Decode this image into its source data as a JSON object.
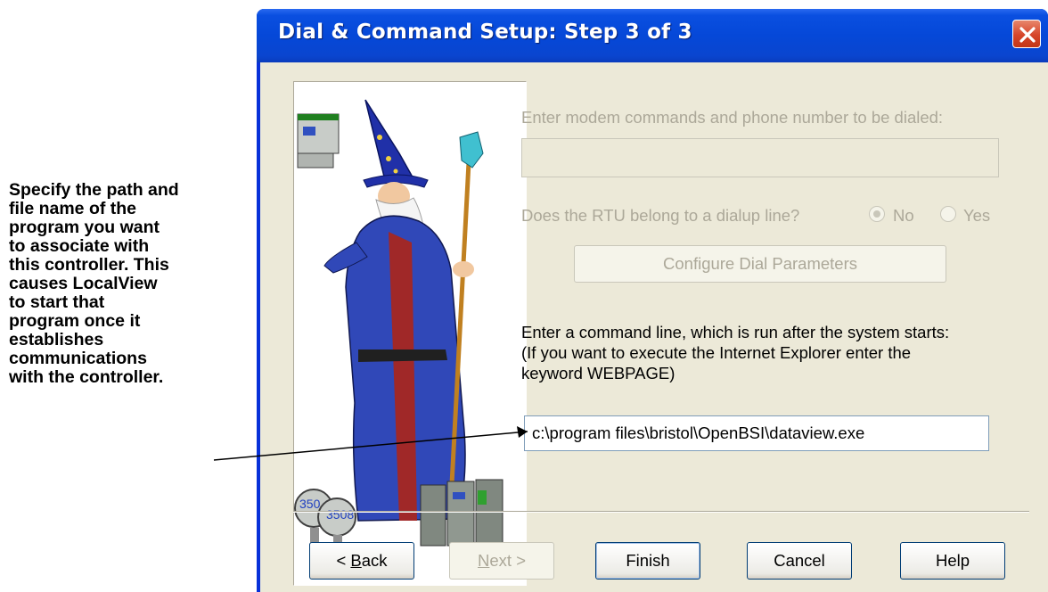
{
  "callout": {
    "lines": [
      "Specify the path and",
      "file name of the",
      "program you want",
      "to associate with",
      "this controller. This",
      "causes LocalView",
      "to start that",
      "program once it",
      "establishes",
      "communications",
      "with the controller."
    ]
  },
  "window": {
    "title": "Dial & Command Setup: Step 3 of 3",
    "close_icon": "close-icon"
  },
  "wizard_image": {
    "icon": "wizard-illustration",
    "badges": [
      "350",
      "3508"
    ]
  },
  "form": {
    "modem_label": "Enter modem commands and phone number to be dialed:",
    "modem_value": "",
    "dialup_question": "Does the RTU belong to a dialup line?",
    "dialup_options": [
      {
        "label": "No",
        "selected": true
      },
      {
        "label": "Yes",
        "selected": false
      }
    ],
    "configure_button": "Configure Dial Parameters",
    "command_label_line1": "Enter a command line, which is run after the system starts:",
    "command_label_line2": "(If you want to execute the Internet Explorer enter the",
    "command_label_line3": "keyword WEBPAGE)",
    "command_value": "c:\\program files\\bristol\\OpenBSI\\dataview.exe"
  },
  "buttons": {
    "back": "< Back",
    "next": "Next >",
    "finish": "Finish",
    "cancel": "Cancel",
    "help": "Help"
  },
  "colors": {
    "titlebar": "#0548d8",
    "client": "#ece9d8",
    "disabled_text": "#aca899",
    "close_button": "#d6452a"
  }
}
